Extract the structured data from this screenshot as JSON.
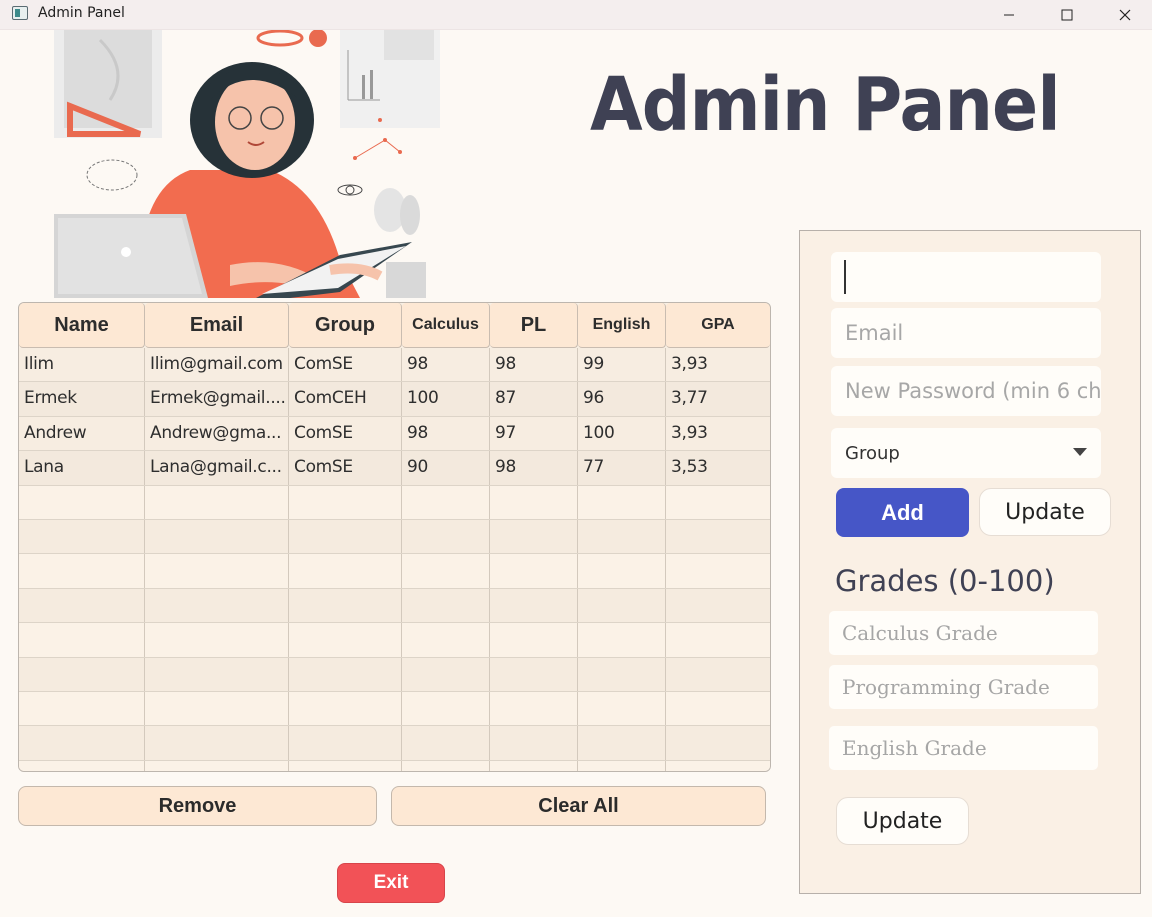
{
  "window": {
    "title": "Admin Panel",
    "controls": [
      "minimize",
      "maximize",
      "close"
    ]
  },
  "header": {
    "title": "Admin Panel"
  },
  "table": {
    "columns": [
      "Name",
      "Email",
      "Group",
      "Calculus",
      "PL",
      "English",
      "GPA"
    ],
    "rows": [
      [
        "Ilim",
        "Ilim@gmail.com",
        "ComSE",
        "98",
        "98",
        "99",
        "3,93"
      ],
      [
        "Ermek",
        "Ermek@gmail....",
        "ComCEH",
        "100",
        "87",
        "96",
        "3,77"
      ],
      [
        "Andrew",
        "Andrew@gma...",
        "ComSE",
        "98",
        "97",
        "100",
        "3,93"
      ],
      [
        "Lana",
        "Lana@gmail.c...",
        "ComSE",
        "90",
        "98",
        "77",
        "3,53"
      ]
    ]
  },
  "actions": {
    "remove": "Remove",
    "clear_all": "Clear All",
    "exit": "Exit"
  },
  "form": {
    "name_value": "",
    "email_placeholder": "Email",
    "password_placeholder": "New Password (min 6 ch",
    "group_selected": "Group",
    "add": "Add",
    "update": "Update"
  },
  "grades": {
    "title": "Grades (0-100)",
    "calculus_placeholder": "Calculus Grade",
    "programming_placeholder": "Programming Grade",
    "english_placeholder": "English Grade",
    "update": "Update"
  },
  "colors": {
    "accent": "#4656c7",
    "exit": "#f25257",
    "header_bg": "#fde8d4",
    "title": "#3f4154"
  }
}
